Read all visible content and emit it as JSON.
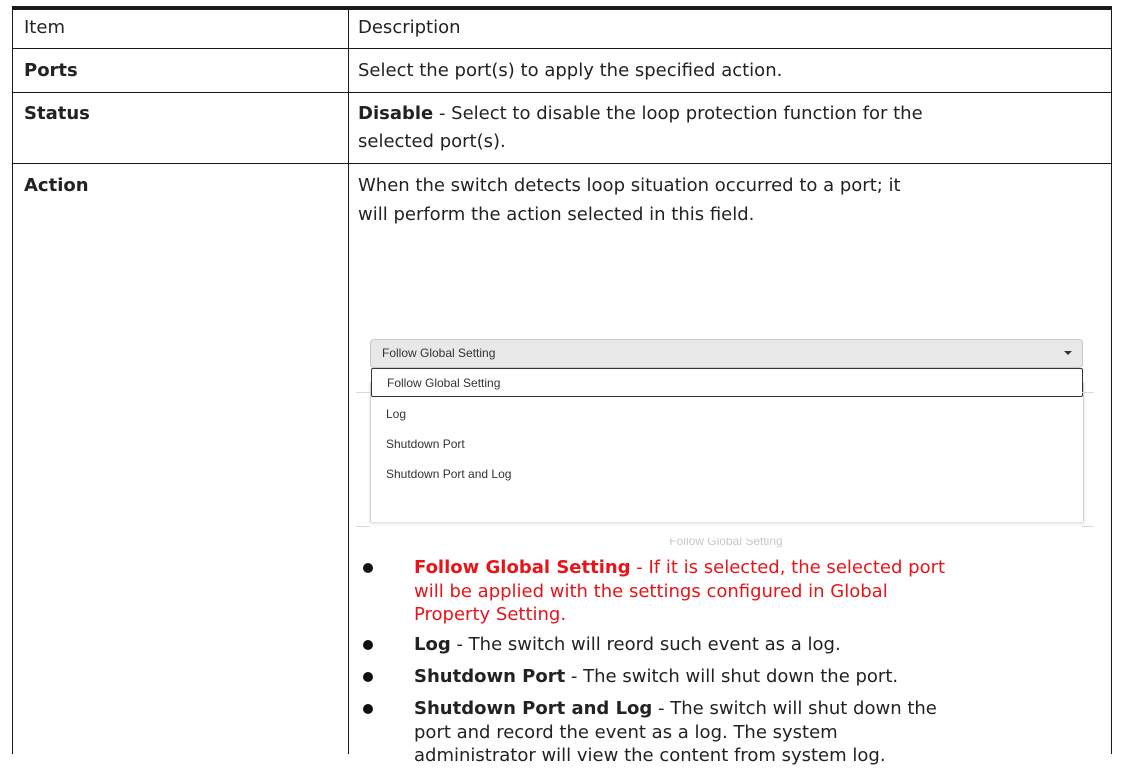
{
  "table": {
    "headers": {
      "item": "Item",
      "description": "Description"
    },
    "rows": {
      "ports": {
        "item": "Ports",
        "desc": "Select the port(s) to apply the specified action."
      },
      "status": {
        "item": "Status",
        "desc_bold": "Disable",
        "desc_line1": " - Select to disable the loop protection function for the",
        "desc_line2": "selected port(s)."
      },
      "action": {
        "item": "Action",
        "intro_line1": "When the switch detects loop situation occurred to a port; it",
        "intro_line2": "will perform the action selected in this field."
      }
    }
  },
  "dropdown": {
    "selected_value": "Follow Global Setting",
    "options": [
      "Follow Global Setting",
      "Log",
      "Shutdown Port",
      "Shutdown Port and Log"
    ],
    "obscured_label": "Follow Global Setting"
  },
  "bullets": {
    "follow": {
      "title": "Follow Global Setting",
      "line1": " - If it is selected, the selected port",
      "line2": "will be applied with the settings configured in Global",
      "line3": "Property Setting.",
      "color": "#e8141a"
    },
    "log": {
      "title": "Log",
      "text": " - The switch will reord such event as a log."
    },
    "shutdown": {
      "title": "Shutdown Port",
      "text": " - The switch will shut down the port."
    },
    "shutdown_log": {
      "title": "Shutdown Port and Log",
      "line1": " - The switch will shut down the",
      "line2": "port and record the event as a log. The system",
      "line3": "administrator will view the content from system log."
    }
  }
}
